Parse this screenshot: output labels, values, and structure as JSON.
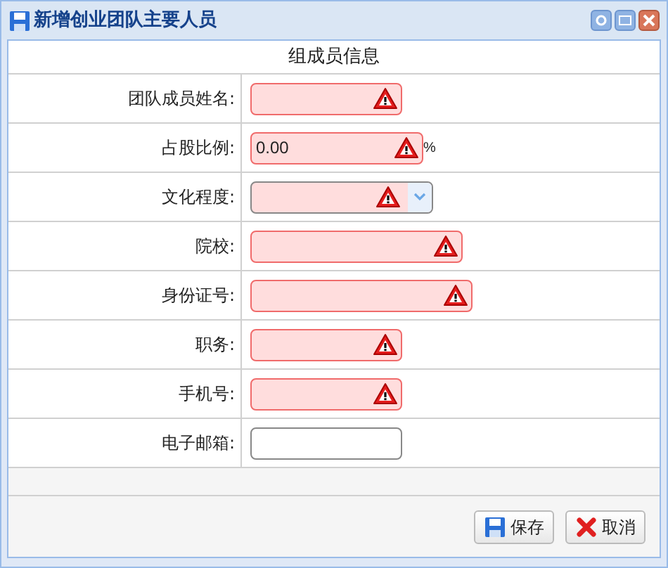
{
  "window": {
    "title": "新增创业团队主要人员"
  },
  "section_title": "组成员信息",
  "fields": [
    {
      "label": "团队成员姓名:",
      "kind": "text",
      "invalid": true
    },
    {
      "label": "占股比例:",
      "kind": "text",
      "invalid": true,
      "value": "0.00",
      "suffix": "%"
    },
    {
      "label": "文化程度:",
      "kind": "select",
      "invalid": true
    },
    {
      "label": "院校:",
      "kind": "text",
      "invalid": true
    },
    {
      "label": "身份证号:",
      "kind": "text",
      "invalid": true
    },
    {
      "label": "职务:",
      "kind": "text",
      "invalid": true
    },
    {
      "label": "手机号:",
      "kind": "text",
      "invalid": true
    },
    {
      "label": "电子邮箱:",
      "kind": "text",
      "invalid": false
    }
  ],
  "buttons": [
    {
      "label": "保存",
      "kind": "save"
    },
    {
      "label": "取消",
      "kind": "cancel"
    }
  ]
}
